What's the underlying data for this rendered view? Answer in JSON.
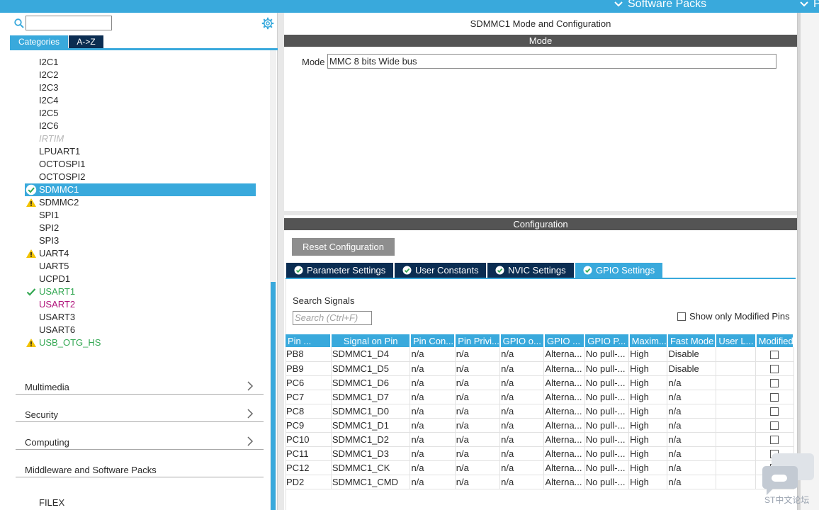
{
  "topbar": {
    "software_packs": "Software Packs",
    "truncated": "P"
  },
  "left": {
    "search_placeholder": "",
    "tabs": {
      "categories": "Categories",
      "az": "A->Z"
    },
    "tree": [
      {
        "label": "I2C1"
      },
      {
        "label": "I2C2"
      },
      {
        "label": "I2C3"
      },
      {
        "label": "I2C4"
      },
      {
        "label": "I2C5"
      },
      {
        "label": "I2C6"
      },
      {
        "label": "IRTIM"
      },
      {
        "label": "LPUART1"
      },
      {
        "label": "OCTOSPI1"
      },
      {
        "label": "OCTOSPI2"
      },
      {
        "label": "SDMMC1"
      },
      {
        "label": "SDMMC2"
      },
      {
        "label": "SPI1"
      },
      {
        "label": "SPI2"
      },
      {
        "label": "SPI3"
      },
      {
        "label": "UART4"
      },
      {
        "label": "UART5"
      },
      {
        "label": "UCPD1"
      },
      {
        "label": "USART1"
      },
      {
        "label": "USART2"
      },
      {
        "label": "USART3"
      },
      {
        "label": "USART6"
      },
      {
        "label": "USB_OTG_HS"
      }
    ],
    "categories": [
      {
        "label": "Multimedia"
      },
      {
        "label": "Security"
      },
      {
        "label": "Computing"
      },
      {
        "label": "Middleware and Software Packs"
      }
    ],
    "filex": "FILEX"
  },
  "right": {
    "title": "SDMMC1 Mode and Configuration",
    "mode_header": "Mode",
    "mode_label": "Mode",
    "mode_value": "MMC 8 bits Wide bus",
    "config_header": "Configuration",
    "reset_button": "Reset Configuration",
    "tabs": {
      "parameter": "Parameter Settings",
      "user_constants": "User Constants",
      "nvic": "NVIC Settings",
      "gpio": "GPIO Settings"
    },
    "search_signals_label": "Search Signals",
    "search_placeholder": "Search (Ctrl+F)",
    "show_modified": "Show only Modified Pins",
    "table": {
      "headers": [
        "Pin ...",
        "Signal on Pin",
        "Pin Con...",
        "Pin Privi...",
        "GPIO o...",
        "GPIO ...",
        "GPIO P...",
        "Maxim...",
        "Fast Mode",
        "User L...",
        "Modified"
      ],
      "rows": [
        [
          "PB8",
          "SDMMC1_D4",
          "n/a",
          "n/a",
          "n/a",
          "Alterna...",
          "No pull-...",
          "High",
          "Disable",
          ""
        ],
        [
          "PB9",
          "SDMMC1_D5",
          "n/a",
          "n/a",
          "n/a",
          "Alterna...",
          "No pull-...",
          "High",
          "Disable",
          ""
        ],
        [
          "PC6",
          "SDMMC1_D6",
          "n/a",
          "n/a",
          "n/a",
          "Alterna...",
          "No pull-...",
          "High",
          "n/a",
          ""
        ],
        [
          "PC7",
          "SDMMC1_D7",
          "n/a",
          "n/a",
          "n/a",
          "Alterna...",
          "No pull-...",
          "High",
          "n/a",
          ""
        ],
        [
          "PC8",
          "SDMMC1_D0",
          "n/a",
          "n/a",
          "n/a",
          "Alterna...",
          "No pull-...",
          "High",
          "n/a",
          ""
        ],
        [
          "PC9",
          "SDMMC1_D1",
          "n/a",
          "n/a",
          "n/a",
          "Alterna...",
          "No pull-...",
          "High",
          "n/a",
          ""
        ],
        [
          "PC10",
          "SDMMC1_D2",
          "n/a",
          "n/a",
          "n/a",
          "Alterna...",
          "No pull-...",
          "High",
          "n/a",
          ""
        ],
        [
          "PC11",
          "SDMMC1_D3",
          "n/a",
          "n/a",
          "n/a",
          "Alterna...",
          "No pull-...",
          "High",
          "n/a",
          ""
        ],
        [
          "PC12",
          "SDMMC1_CK",
          "n/a",
          "n/a",
          "n/a",
          "Alterna...",
          "No pull-...",
          "High",
          "n/a",
          ""
        ],
        [
          "PD2",
          "SDMMC1_CMD",
          "n/a",
          "n/a",
          "n/a",
          "Alterna...",
          "No pull-...",
          "High",
          "n/a",
          ""
        ]
      ]
    }
  },
  "watermark": {
    "text": "ST中文论坛"
  },
  "colors": {
    "accent": "#39a9dc",
    "dark_navy": "#0b2d52",
    "header_gray": "#545454",
    "warning": "#f2c200",
    "ok_green": "#34a853",
    "magenta": "#b0127a"
  }
}
